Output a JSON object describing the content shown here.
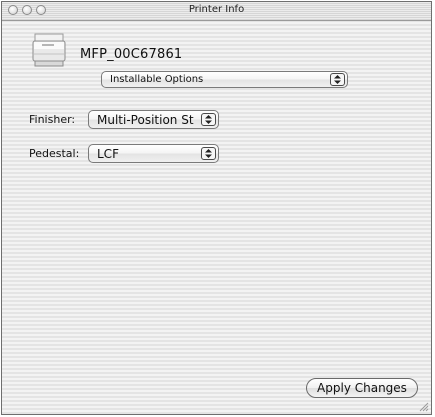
{
  "window": {
    "title": "Printer Info"
  },
  "printer": {
    "name": "MFP_00C67861",
    "icon": "printer-icon"
  },
  "view_popup": {
    "selected": "Installable Options"
  },
  "options": {
    "finisher": {
      "label": "Finisher:",
      "value": "Multi-Position St"
    },
    "pedestal": {
      "label": "Pedestal:",
      "value": "LCF"
    }
  },
  "buttons": {
    "apply_label": "Apply Changes"
  },
  "colors": {
    "window_stripe_light": "#f3f3f3",
    "window_stripe_dark": "#e4e4e4",
    "border": "#6e6e6e"
  }
}
